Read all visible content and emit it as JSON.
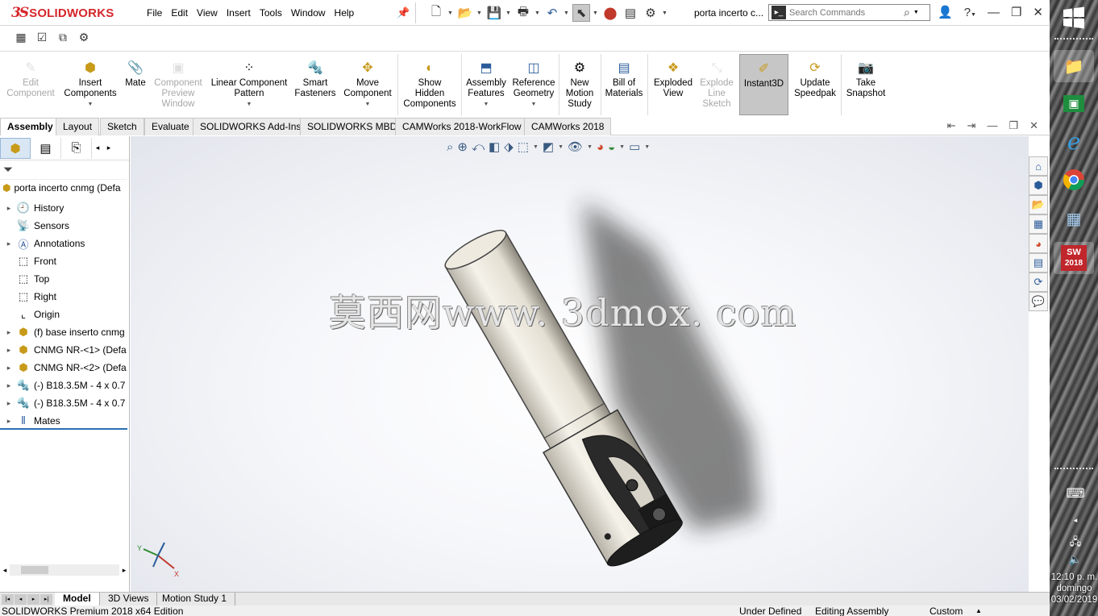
{
  "app": {
    "logo_ds": "3S",
    "logo_text": "SOLIDWORKS",
    "menus": [
      "File",
      "Edit",
      "View",
      "Insert",
      "Tools",
      "Window",
      "Help"
    ],
    "doc_title": "porta incerto c...",
    "search_placeholder": "Search Commands"
  },
  "ribbon": {
    "edit_component": "Edit\nComponent",
    "insert_components": "Insert\nComponents",
    "mate": "Mate",
    "component_preview": "Component\nPreview\nWindow",
    "linear_pattern": "Linear Component\nPattern",
    "smart_fasteners": "Smart\nFasteners",
    "move_component": "Move\nComponent",
    "show_hidden": "Show\nHidden\nComponents",
    "assembly_features": "Assembly\nFeatures",
    "reference_geometry": "Reference\nGeometry",
    "new_motion_study": "New\nMotion\nStudy",
    "bill_of_materials": "Bill of\nMaterials",
    "exploded_view": "Exploded\nView",
    "explode_line_sketch": "Explode\nLine\nSketch",
    "instant3d": "Instant3D",
    "update_speedpak": "Update\nSpeedpak",
    "take_snapshot": "Take\nSnapshot"
  },
  "tabs": [
    "Assembly",
    "Layout",
    "Sketch",
    "Evaluate",
    "SOLIDWORKS Add-Ins",
    "SOLIDWORKS MBD",
    "CAMWorks 2018-WorkFlow",
    "CAMWorks 2018"
  ],
  "tree": {
    "root": "porta incerto cnmg  (Defa",
    "items": [
      {
        "label": "History",
        "icon": "history-icon",
        "exp": true
      },
      {
        "label": "Sensors",
        "icon": "sensors-icon",
        "exp": false
      },
      {
        "label": "Annotations",
        "icon": "annotations-icon",
        "exp": true
      },
      {
        "label": "Front",
        "icon": "plane-icon",
        "exp": false
      },
      {
        "label": "Top",
        "icon": "plane-icon",
        "exp": false
      },
      {
        "label": "Right",
        "icon": "plane-icon",
        "exp": false
      },
      {
        "label": "Origin",
        "icon": "origin-icon",
        "exp": false
      },
      {
        "label": "(f) base inserto cnmg",
        "icon": "part-icon",
        "exp": true
      },
      {
        "label": "CNMG NR-<1> (Defa",
        "icon": "part-icon",
        "exp": true
      },
      {
        "label": "CNMG NR-<2> (Defa",
        "icon": "part-icon",
        "exp": true
      },
      {
        "label": "(-) B18.3.5M - 4 x 0.7",
        "icon": "screw-icon",
        "exp": true
      },
      {
        "label": "(-) B18.3.5M - 4 x 0.7",
        "icon": "screw-icon",
        "exp": true
      },
      {
        "label": "Mates",
        "icon": "mates-icon",
        "exp": true
      }
    ]
  },
  "watermark": "莫西网www. 3dmox. com",
  "bottom_tabs": [
    "Model",
    "3D Views",
    "Motion Study 1"
  ],
  "status": {
    "edition": "SOLIDWORKS Premium 2018 x64 Edition",
    "state": "Under Defined",
    "mode": "Editing Assembly",
    "units": "Custom"
  },
  "clock": {
    "time": "12:10 p. m.",
    "day": "domingo",
    "date": "03/02/2019"
  },
  "taskbar_badge": "2018",
  "colors": {
    "brand_red": "#d5262b",
    "selection_blue": "#2a6fb5",
    "instant3d_active": "#c6c6c6"
  }
}
